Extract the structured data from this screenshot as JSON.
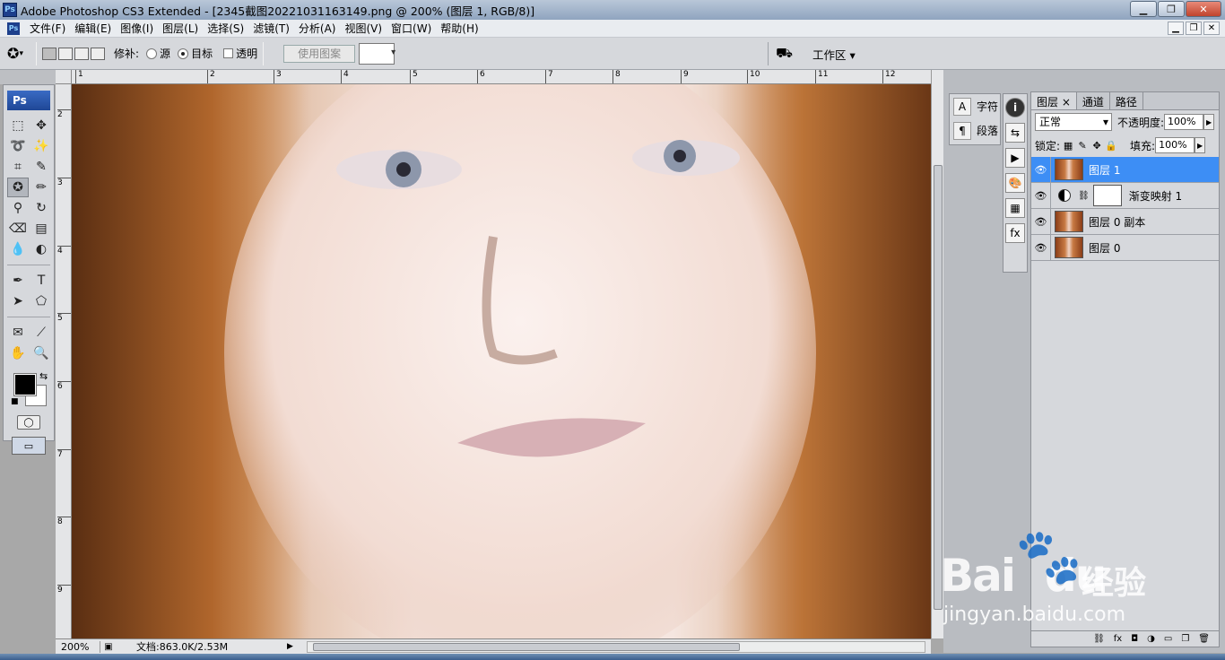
{
  "titlebar": {
    "app_icon": "Ps",
    "title": "Adobe Photoshop CS3 Extended - [2345截图20221031163149.png @ 200% (图层 1, RGB/8)]",
    "minimize": "▁",
    "maximize": "❐",
    "close": "✕"
  },
  "menubar": {
    "items": [
      "文件(F)",
      "编辑(E)",
      "图像(I)",
      "图层(L)",
      "选择(S)",
      "滤镜(T)",
      "分析(A)",
      "视图(V)",
      "窗口(W)",
      "帮助(H)"
    ],
    "doc_minimize": "▁",
    "doc_restore": "❐",
    "doc_close": "✕"
  },
  "options": {
    "repair_label": "修补:",
    "source_label": "源",
    "target_label": "目标",
    "transparent_label": "透明",
    "use_pattern_label": "使用图案",
    "workspace_label": "工作区 ▾",
    "mode": "target"
  },
  "toolbox": {
    "logo": "Ps",
    "tools": [
      {
        "name": "rectangle-marquee",
        "glyph": "⬚"
      },
      {
        "name": "move",
        "glyph": "✥"
      },
      {
        "name": "lasso",
        "glyph": "➰"
      },
      {
        "name": "magic-wand",
        "glyph": "✨"
      },
      {
        "name": "crop",
        "glyph": "⌗"
      },
      {
        "name": "slice",
        "glyph": "✎"
      },
      {
        "name": "patch",
        "glyph": "✪",
        "active": true
      },
      {
        "name": "brush",
        "glyph": "✏"
      },
      {
        "name": "clone-stamp",
        "glyph": "⚲"
      },
      {
        "name": "history-brush",
        "glyph": "↻"
      },
      {
        "name": "eraser",
        "glyph": "⌫"
      },
      {
        "name": "gradient",
        "glyph": "▤"
      },
      {
        "name": "blur",
        "glyph": "💧"
      },
      {
        "name": "dodge",
        "glyph": "◐"
      },
      {
        "name": "pen",
        "glyph": "✒"
      },
      {
        "name": "type",
        "glyph": "T"
      },
      {
        "name": "path-selection",
        "glyph": "➤"
      },
      {
        "name": "shape",
        "glyph": "⬠"
      },
      {
        "name": "notes",
        "glyph": "✉"
      },
      {
        "name": "eyedropper",
        "glyph": "⟋"
      },
      {
        "name": "hand",
        "glyph": "✋"
      },
      {
        "name": "zoom",
        "glyph": "🔍"
      }
    ],
    "quickmask_glyph": "◯",
    "screenmode_glyph": "▭"
  },
  "rulers": {
    "top_labels": [
      "1",
      "2",
      "3",
      "4",
      "5",
      "6",
      "7",
      "8",
      "9",
      "10",
      "11",
      "12"
    ],
    "left_labels": [
      "2",
      "3",
      "4",
      "5",
      "6",
      "7",
      "8",
      "9"
    ]
  },
  "status": {
    "zoom": "200%",
    "doc_info": "文档:863.0K/2.53M"
  },
  "charpara": {
    "char_icon": "A",
    "char_label": "字符",
    "para_icon": "¶",
    "para_label": "段落"
  },
  "icon_strip": [
    "i",
    "⇆",
    "▶",
    "🎨",
    "▦",
    "fx"
  ],
  "layers_panel": {
    "tabs": [
      "图层",
      "通道",
      "路径"
    ],
    "active_tab": "图层",
    "tab_close": "×",
    "blend_mode": "正常",
    "opacity_label": "不透明度:",
    "opacity_value": "100%",
    "lock_label": "锁定:",
    "fill_label": "填充:",
    "fill_value": "100%",
    "layers": [
      {
        "name": "图层 1",
        "type": "image",
        "selected": true
      },
      {
        "name": "渐变映射 1",
        "type": "adjustment",
        "selected": false
      },
      {
        "name": "图层 0 副本",
        "type": "image",
        "selected": false
      },
      {
        "name": "图层 0",
        "type": "image",
        "selected": false
      }
    ],
    "footer_icons": [
      "⛓",
      "fx",
      "◘",
      "◑",
      "▭",
      "❐",
      "🗑"
    ]
  },
  "watermark": {
    "logo_text": "Bai",
    "logo_tail": "du",
    "paw": "🐾",
    "cn_text": "经验",
    "url": "jingyan.baidu.com"
  }
}
